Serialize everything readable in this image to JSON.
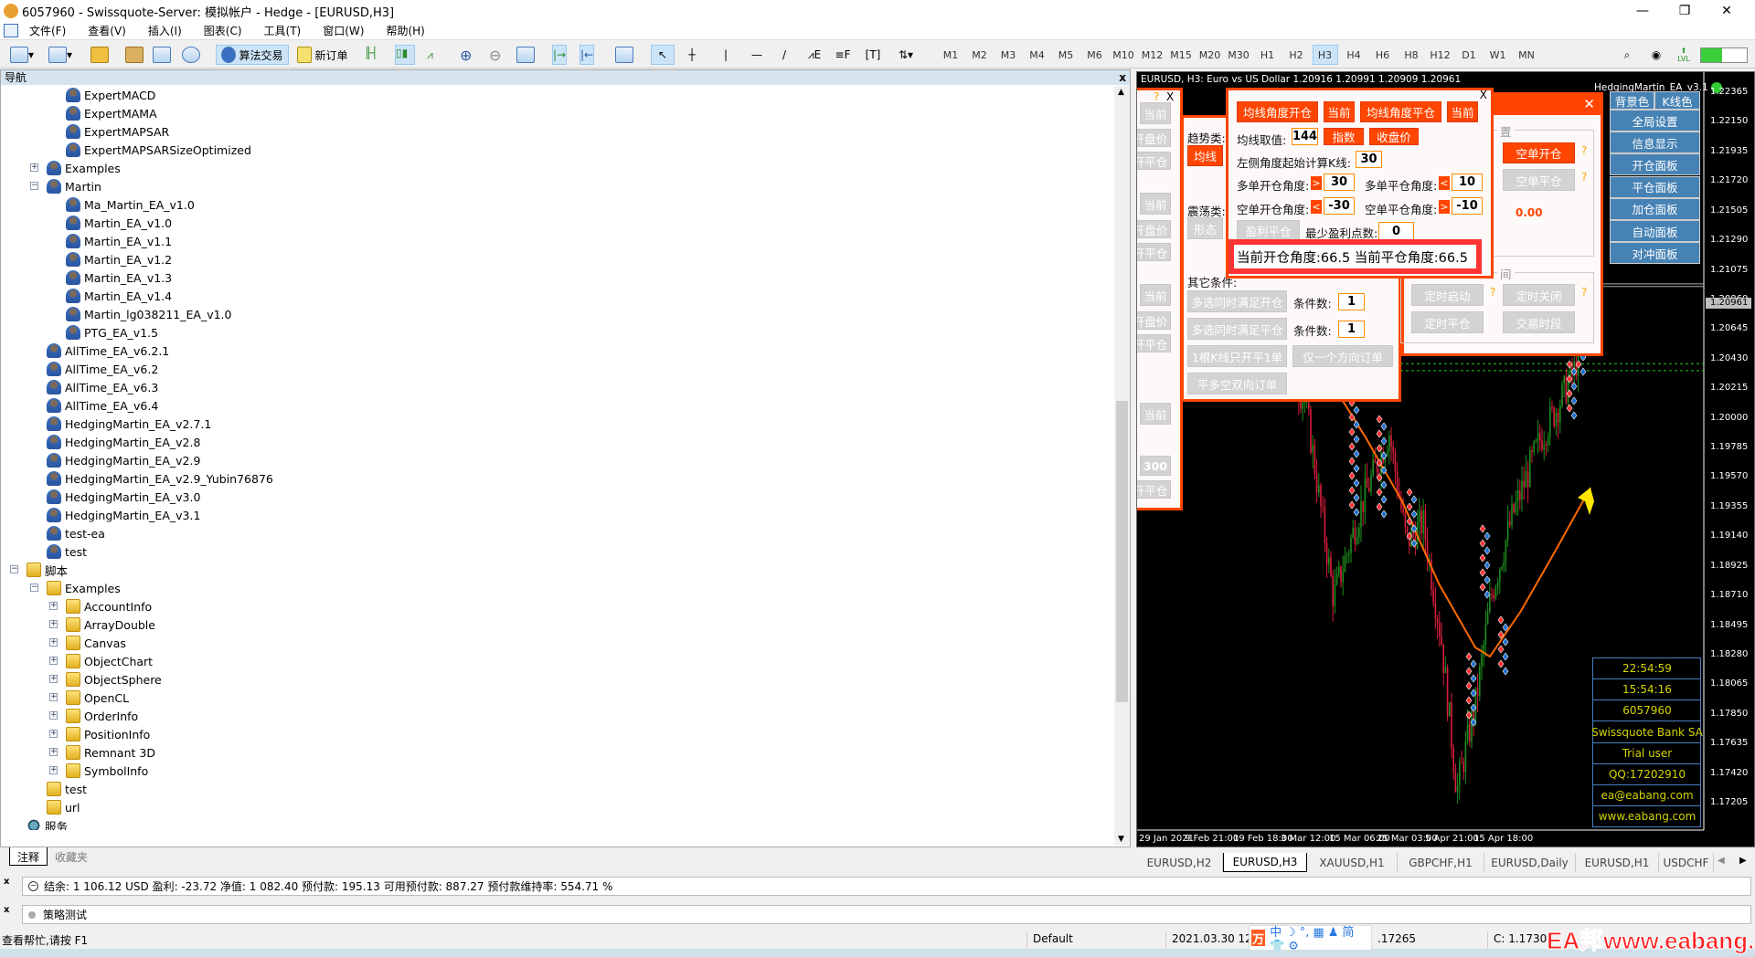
{
  "window": {
    "title": "6057960 - Swissquote-Server: 模拟帐户 - Hedge - [EURUSD,H3]",
    "controls": [
      "—",
      "❐",
      "✕"
    ]
  },
  "menu": [
    "文件(F)",
    "查看(V)",
    "插入(I)",
    "图表(C)",
    "工具(T)",
    "窗口(W)",
    "帮助(H)"
  ],
  "toolbar": {
    "algo_trading": "算法交易",
    "new_order": "新订单",
    "timeframes": [
      "M1",
      "M2",
      "M3",
      "M4",
      "M5",
      "M6",
      "M10",
      "M12",
      "M15",
      "M20",
      "M30",
      "H1",
      "H2",
      "H3",
      "H4",
      "H6",
      "H8",
      "H12",
      "D1",
      "W1",
      "MN"
    ],
    "active_timeframe": "H3",
    "connection_label": "LVL"
  },
  "navigator": {
    "title": "导航",
    "close": "x",
    "items": [
      {
        "label": "ExpertMACD",
        "level": 3,
        "icon": "ea"
      },
      {
        "label": "ExpertMAMA",
        "level": 3,
        "icon": "ea"
      },
      {
        "label": "ExpertMAPSAR",
        "level": 3,
        "icon": "ea"
      },
      {
        "label": "ExpertMAPSARSizeOptimized",
        "level": 3,
        "icon": "ea"
      },
      {
        "label": "Examples",
        "level": 2,
        "icon": "ea-folder",
        "expander": "+"
      },
      {
        "label": "Martin",
        "level": 2,
        "icon": "ea-folder",
        "expander": "−"
      },
      {
        "label": "Ma_Martin_EA_v1.0",
        "level": 3,
        "icon": "ea"
      },
      {
        "label": "Martin_EA_v1.0",
        "level": 3,
        "icon": "ea"
      },
      {
        "label": "Martin_EA_v1.1",
        "level": 3,
        "icon": "ea"
      },
      {
        "label": "Martin_EA_v1.2",
        "level": 3,
        "icon": "ea"
      },
      {
        "label": "Martin_EA_v1.3",
        "level": 3,
        "icon": "ea"
      },
      {
        "label": "Martin_EA_v1.4",
        "level": 3,
        "icon": "ea"
      },
      {
        "label": "Martin_lg038211_EA_v1.0",
        "level": 3,
        "icon": "ea"
      },
      {
        "label": "PTG_EA_v1.5",
        "level": 3,
        "icon": "ea"
      },
      {
        "label": "AllTime_EA_v6.2.1",
        "level": 2,
        "icon": "ea"
      },
      {
        "label": "AllTime_EA_v6.2",
        "level": 2,
        "icon": "ea"
      },
      {
        "label": "AllTime_EA_v6.3",
        "level": 2,
        "icon": "ea"
      },
      {
        "label": "AllTime_EA_v6.4",
        "level": 2,
        "icon": "ea"
      },
      {
        "label": "HedgingMartin_EA_v2.7.1",
        "level": 2,
        "icon": "ea"
      },
      {
        "label": "HedgingMartin_EA_v2.8",
        "level": 2,
        "icon": "ea"
      },
      {
        "label": "HedgingMartin_EA_v2.9",
        "level": 2,
        "icon": "ea"
      },
      {
        "label": "HedgingMartin_EA_v2.9_Yubin76876",
        "level": 2,
        "icon": "ea"
      },
      {
        "label": "HedgingMartin_EA_v3.0",
        "level": 2,
        "icon": "ea"
      },
      {
        "label": "HedgingMartin_EA_v3.1",
        "level": 2,
        "icon": "ea"
      },
      {
        "label": "test-ea",
        "level": 2,
        "icon": "ea"
      },
      {
        "label": "test",
        "level": 2,
        "icon": "ea"
      },
      {
        "label": "脚本",
        "level": 1,
        "icon": "folder",
        "expander": "−"
      },
      {
        "label": "Examples",
        "level": 2,
        "icon": "folder",
        "expander": "−"
      },
      {
        "label": "AccountInfo",
        "level": 3,
        "icon": "folder",
        "expander": "+"
      },
      {
        "label": "ArrayDouble",
        "level": 3,
        "icon": "folder",
        "expander": "+"
      },
      {
        "label": "Canvas",
        "level": 3,
        "icon": "folder",
        "expander": "+"
      },
      {
        "label": "ObjectChart",
        "level": 3,
        "icon": "folder",
        "expander": "+"
      },
      {
        "label": "ObjectSphere",
        "level": 3,
        "icon": "folder",
        "expander": "+"
      },
      {
        "label": "OpenCL",
        "level": 3,
        "icon": "folder",
        "expander": "+"
      },
      {
        "label": "OrderInfo",
        "level": 3,
        "icon": "folder",
        "expander": "+"
      },
      {
        "label": "PositionInfo",
        "level": 3,
        "icon": "folder",
        "expander": "+"
      },
      {
        "label": "Remnant 3D",
        "level": 3,
        "icon": "folder",
        "expander": "+"
      },
      {
        "label": "SymbolInfo",
        "level": 3,
        "icon": "folder",
        "expander": "+"
      },
      {
        "label": "test",
        "level": 2,
        "icon": "folder"
      },
      {
        "label": "url",
        "level": 2,
        "icon": "folder"
      },
      {
        "label": "服务",
        "level": 1,
        "icon": "services"
      }
    ],
    "tabs": [
      "注释",
      "收藏夹"
    ],
    "active_tab": "注释"
  },
  "chart": {
    "header": "EURUSD, H3:  Euro vs US Dollar  1.20916 1.20991 1.20909 1.20961",
    "ea_name": "HedgingMartin_EA_v3.1",
    "price_labels": [
      "1.22365",
      "1.22150",
      "1.21935",
      "1.21720",
      "1.21505",
      "1.21290",
      "1.21075",
      "1.20860",
      "1.20645",
      "1.20430",
      "1.20215",
      "1.20000",
      "1.19785",
      "1.19570",
      "1.19355",
      "1.19140",
      "1.18925",
      "1.18710",
      "1.18495",
      "1.18280",
      "1.18065",
      "1.17850",
      "1.17635",
      "1.17420",
      "1.17205"
    ],
    "current_price": "1.20961",
    "time_labels": [
      "29 Jan 2021",
      "9 Feb 21:00",
      "19 Feb 18:00",
      "3 Mar 12:00",
      "15 Mar 06:00",
      "25 Mar 03:00",
      "5 Apr 21:00",
      "15 Apr 18:00"
    ],
    "colors": {
      "bull": "#1e8f1e",
      "bear": "#d81e3c",
      "ma": "#ff6a00",
      "arrow": "#ffe600",
      "panel_accent": "#ff4500",
      "menu_blue": "#4682b4",
      "info_text": "#d4d400"
    }
  },
  "left_panel": {
    "help": "?",
    "close": "X",
    "buttons": [
      "当前",
      "开盘价",
      "开平仓",
      "当前",
      "开盘价",
      "开平仓",
      "当前",
      "开盘价",
      "开平仓",
      "当前",
      "开平仓"
    ],
    "value": "300"
  },
  "conditions_panel": {
    "trend_label": "趋势类:",
    "trend_button": "均线",
    "osc_label": "震荡类:",
    "osc_button": "形态",
    "other_label": "其它条件:",
    "multi_open": "多选同时满足开仓",
    "multi_close": "多选同时满足平仓",
    "count_label": "条件数:",
    "count_open": "1",
    "count_close": "1",
    "one_per_bar": "1根K线只开平1单",
    "one_direction": "仅一个方向订单",
    "bidirectional": "平多空双向订单"
  },
  "ma_panel": {
    "close": "X",
    "ma_open": "均线角度开仓",
    "current1": "当前",
    "ma_close": "均线角度平仓",
    "current2": "当前",
    "ma_value_label": "均线取值:",
    "ma_value": "144",
    "ma_method": "指数",
    "ma_price": "收盘价",
    "start_bar_label": "左侧角度起始计算K线:",
    "start_bar": "30",
    "long_open_label": "多单开仓角度:",
    "long_open_op": ">",
    "long_open": "30",
    "long_close_label": "多单平仓角度:",
    "long_close_op": "<",
    "long_close": "10",
    "short_open_label": "空单开仓角度:",
    "short_open_op": "<",
    "short_open": "-30",
    "short_close_label": "空单平仓角度:",
    "short_close_op": ">",
    "short_close": "-10",
    "profit_close": "盈利平仓",
    "min_profit_label": "最少盈利点数:",
    "min_profit": "0",
    "status": "当前开仓角度:66.5 当前平仓角度:66.5"
  },
  "right_panel": {
    "close": "✕",
    "group1": "置",
    "short_open": "空单开仓",
    "short_close": "空单平仓",
    "help": "?",
    "value": "0.00",
    "group2": "间",
    "timer_start": "定时启动",
    "timer_stop": "定时关闭",
    "timer_close": "定时平仓",
    "sessions": "交易时段"
  },
  "ea_menu": {
    "bg_color": "背景色",
    "candle_color": "K线色",
    "items": [
      "全局设置",
      "信息显示",
      "开仓面板",
      "平仓面板",
      "加仓面板",
      "自动面板",
      "对冲面板"
    ]
  },
  "info_box": [
    "22:54:59",
    "15:54:16",
    "6057960",
    "Swissquote Bank SA",
    "Trial user",
    "QQ:17202910",
    "ea@eabang.com",
    "www.eabang.com"
  ],
  "chart_tabs": [
    "EURUSD,H2",
    "EURUSD,H3",
    "XAUUSD,H1",
    "GBPCHF,H1",
    "EURUSD,Daily",
    "EURUSD,H1",
    "USDCHF"
  ],
  "active_chart_tab": "EURUSD,H3",
  "account": "结余: 1 106.12 USD  盈利: -23.72  净值: 1 082.40  预付款: 195.13  可用预付款: 887.27  预付款维持率: 554.71 %",
  "strategy_tester": "策略测试",
  "statusbar": {
    "help": "查看帮忙,请按 F1",
    "profile": "Default",
    "datetime": "2021.03.30 12:",
    "low": ".17265",
    "close": "C: 1.1730"
  },
  "ime": [
    "中",
    "☽",
    "°,",
    "▦",
    "♟",
    "简",
    "👕",
    "⚙"
  ],
  "watermark": "EA邦www.eabang.com"
}
